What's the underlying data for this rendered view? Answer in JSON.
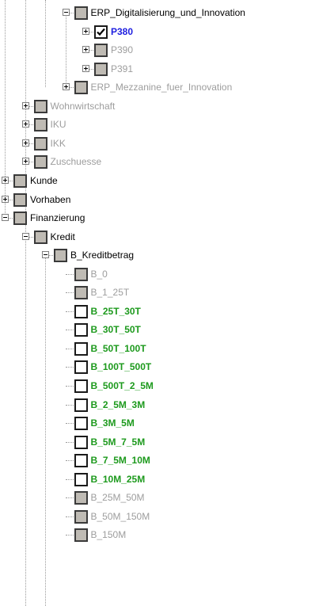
{
  "tree": {
    "nodes": [
      {
        "label": "ERP_Digitalisierung_und_Innovation",
        "level": 4,
        "expander": "minus",
        "checkbox": "partial",
        "style": "normal"
      },
      {
        "label": "P380",
        "level": 5,
        "expander": "plus",
        "checkbox": "checked",
        "style": "selected"
      },
      {
        "label": "P390",
        "level": 5,
        "expander": "plus",
        "checkbox": "disabled",
        "style": "disabled"
      },
      {
        "label": "P391",
        "level": 5,
        "expander": "plus",
        "checkbox": "disabled",
        "style": "disabled"
      },
      {
        "label": "ERP_Mezzanine_fuer_Innovation",
        "level": 4,
        "expander": "plus",
        "checkbox": "disabled",
        "style": "disabled"
      },
      {
        "label": "Wohnwirtschaft",
        "level": 2,
        "expander": "plus",
        "checkbox": "disabled",
        "style": "disabled"
      },
      {
        "label": "IKU",
        "level": 2,
        "expander": "plus",
        "checkbox": "disabled",
        "style": "disabled"
      },
      {
        "label": "IKK",
        "level": 2,
        "expander": "plus",
        "checkbox": "disabled",
        "style": "disabled"
      },
      {
        "label": "Zuschuesse",
        "level": 2,
        "expander": "plus",
        "checkbox": "disabled",
        "style": "disabled"
      },
      {
        "label": "Kunde",
        "level": 1,
        "expander": "plus",
        "checkbox": "partial",
        "style": "normal"
      },
      {
        "label": "Vorhaben",
        "level": 1,
        "expander": "plus",
        "checkbox": "partial",
        "style": "normal"
      },
      {
        "label": "Finanzierung",
        "level": 1,
        "expander": "minus",
        "checkbox": "partial",
        "style": "normal"
      },
      {
        "label": "Kredit",
        "level": 2,
        "expander": "minus",
        "checkbox": "partial",
        "style": "normal"
      },
      {
        "label": "B_Kreditbetrag",
        "level": 3,
        "expander": "minus",
        "checkbox": "partial",
        "style": "normal"
      },
      {
        "label": "B_0",
        "level": 4,
        "expander": "none",
        "checkbox": "disabled",
        "style": "disabled"
      },
      {
        "label": "B_1_25T",
        "level": 4,
        "expander": "none",
        "checkbox": "disabled",
        "style": "disabled"
      },
      {
        "label": "B_25T_30T",
        "level": 4,
        "expander": "none",
        "checkbox": "unchecked",
        "style": "green"
      },
      {
        "label": "B_30T_50T",
        "level": 4,
        "expander": "none",
        "checkbox": "unchecked",
        "style": "green"
      },
      {
        "label": "B_50T_100T",
        "level": 4,
        "expander": "none",
        "checkbox": "unchecked",
        "style": "green"
      },
      {
        "label": "B_100T_500T",
        "level": 4,
        "expander": "none",
        "checkbox": "unchecked",
        "style": "green"
      },
      {
        "label": "B_500T_2_5M",
        "level": 4,
        "expander": "none",
        "checkbox": "unchecked",
        "style": "green"
      },
      {
        "label": "B_2_5M_3M",
        "level": 4,
        "expander": "none",
        "checkbox": "unchecked",
        "style": "green"
      },
      {
        "label": "B_3M_5M",
        "level": 4,
        "expander": "none",
        "checkbox": "unchecked",
        "style": "green"
      },
      {
        "label": "B_5M_7_5M",
        "level": 4,
        "expander": "none",
        "checkbox": "unchecked",
        "style": "green"
      },
      {
        "label": "B_7_5M_10M",
        "level": 4,
        "expander": "none",
        "checkbox": "unchecked",
        "style": "green"
      },
      {
        "label": "B_10M_25M",
        "level": 4,
        "expander": "none",
        "checkbox": "unchecked",
        "style": "green"
      },
      {
        "label": "B_25M_50M",
        "level": 4,
        "expander": "none",
        "checkbox": "disabled",
        "style": "disabled"
      },
      {
        "label": "B_50M_150M",
        "level": 4,
        "expander": "none",
        "checkbox": "disabled",
        "style": "disabled"
      },
      {
        "label": "B_150M",
        "level": 4,
        "expander": "none",
        "checkbox": "disabled",
        "style": "disabled"
      }
    ]
  },
  "colors": {
    "normal_text": "#000000",
    "disabled_text": "#9d9d9d",
    "selected_text": "#2020e0",
    "available_text": "#1d9a1d",
    "checkbox_partial_fill": "#bfbbb4",
    "tree_lines": "#9a9a9a"
  },
  "icons": {
    "expand": "plus-box-icon",
    "collapse": "minus-box-icon",
    "checked": "checkmark-icon"
  }
}
